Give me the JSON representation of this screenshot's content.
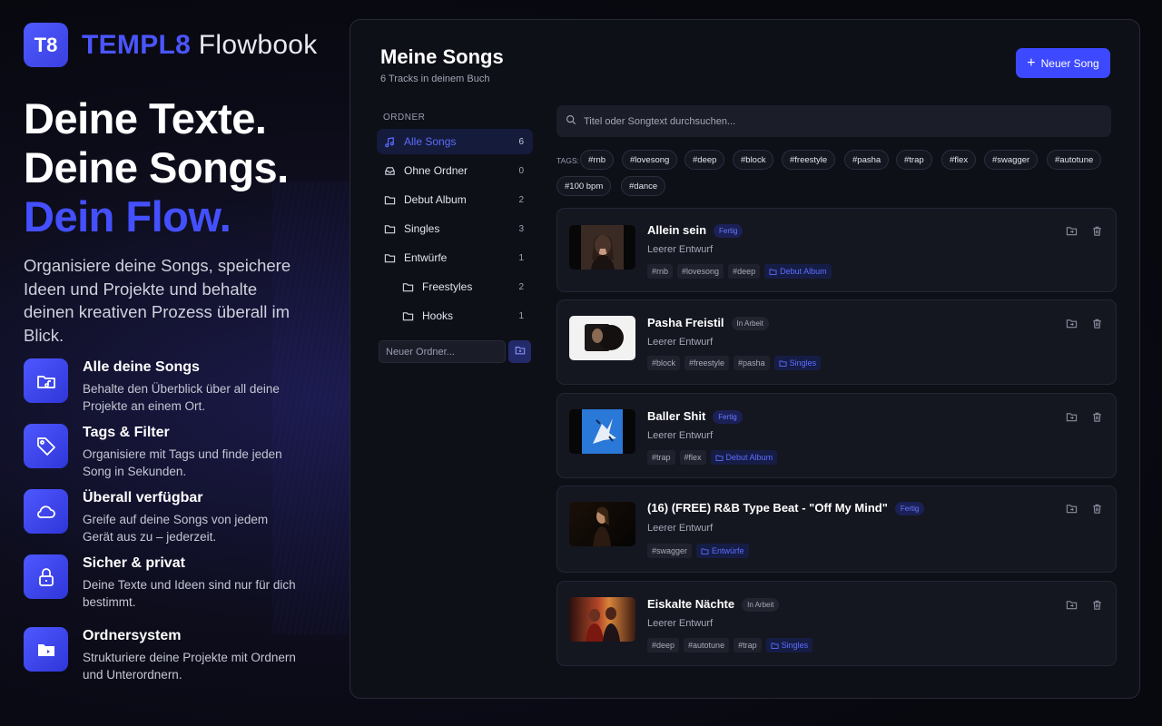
{
  "brand": {
    "logo_text": "T8",
    "name_bold": "TEMPL8",
    "name_light": "Flowbook"
  },
  "hero": {
    "line1": "Deine Texte.",
    "line2": "Deine Songs.",
    "line3": "Dein Flow."
  },
  "intro": "Organisiere deine Songs, speichere Ideen und Projekte und behalte deinen kreativen Prozess überall im Blick.",
  "features": [
    {
      "icon": "music-folder-icon",
      "title": "Alle deine Songs",
      "desc": "Behalte den Überblick über all deine Projekte an einem Ort."
    },
    {
      "icon": "tag-icon",
      "title": "Tags & Filter",
      "desc": "Organisiere mit Tags und finde jeden Song in Sekunden."
    },
    {
      "icon": "cloud-icon",
      "title": "Überall verfügbar",
      "desc": "Greife auf deine Songs von jedem Gerät aus zu – jederzeit."
    },
    {
      "icon": "lock-icon",
      "title": "Sicher & privat",
      "desc": "Deine Texte und Ideen sind nur für dich bestimmt."
    },
    {
      "icon": "folder-icon",
      "title": "Ordnersystem",
      "desc": "Strukturiere deine Projekte mit Ordnern und Unterordnern."
    }
  ],
  "panel": {
    "title": "Meine Songs",
    "subtitle": "6 Tracks in deinem Buch",
    "new_song_label": "Neuer Song"
  },
  "folders": {
    "heading": "ORDNER",
    "items": [
      {
        "label": "Alle Songs",
        "count": "6",
        "icon": "music-note-icon",
        "active": true
      },
      {
        "label": "Ohne Ordner",
        "count": "0",
        "icon": "inbox-icon"
      },
      {
        "label": "Debut Album",
        "count": "2",
        "icon": "folder-icon"
      },
      {
        "label": "Singles",
        "count": "3",
        "icon": "folder-icon"
      },
      {
        "label": "Entwürfe",
        "count": "1",
        "icon": "folder-icon"
      },
      {
        "label": "Freestyles",
        "count": "2",
        "icon": "folder-icon",
        "sub": true
      },
      {
        "label": "Hooks",
        "count": "1",
        "icon": "folder-icon",
        "sub": true
      }
    ],
    "new_folder_placeholder": "Neuer Ordner..."
  },
  "search": {
    "placeholder": "Titel oder Songtext durchsuchen..."
  },
  "tags": {
    "label": "TAGS:",
    "items": [
      "#rnb",
      "#lovesong",
      "#deep",
      "#block",
      "#freestyle",
      "#pasha",
      "#trap",
      "#flex",
      "#swagger",
      "#autotune",
      "#100 bpm",
      "#dance"
    ]
  },
  "songs": [
    {
      "title": "Allein sein",
      "status": "Fertig",
      "status_type": "done",
      "subtitle": "Leerer Entwurf",
      "tags": [
        "#rnb",
        "#lovesong",
        "#deep"
      ],
      "folder": "Debut Album"
    },
    {
      "title": "Pasha Freistil",
      "status": "In Arbeit",
      "status_type": "wip",
      "subtitle": "Leerer Entwurf",
      "tags": [
        "#block",
        "#freestyle",
        "#pasha"
      ],
      "folder": "Singles"
    },
    {
      "title": "Baller Shit",
      "status": "Fertig",
      "status_type": "done",
      "subtitle": "Leerer Entwurf",
      "tags": [
        "#trap",
        "#flex"
      ],
      "folder": "Debut Album"
    },
    {
      "title": "(16) (FREE) R&B Type Beat - \"Off My Mind\"",
      "status": "Fertig",
      "status_type": "done",
      "subtitle": "Leerer Entwurf",
      "tags": [
        "#swagger"
      ],
      "folder": "Entwürfe"
    },
    {
      "title": "Eiskalte Nächte",
      "status": "In Arbeit",
      "status_type": "wip",
      "subtitle": "Leerer Entwurf",
      "tags": [
        "#deep",
        "#autotune",
        "#trap"
      ],
      "folder": "Singles"
    }
  ]
}
